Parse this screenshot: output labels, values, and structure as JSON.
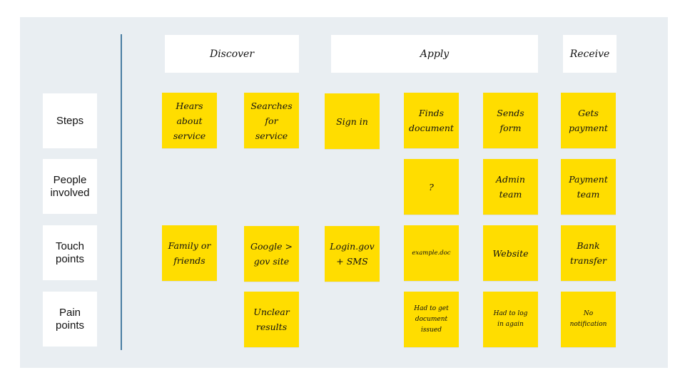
{
  "phases": [
    {
      "label": "Discover"
    },
    {
      "label": "Apply"
    },
    {
      "label": "Receive"
    }
  ],
  "rows": [
    {
      "label": "Steps"
    },
    {
      "label": "People\ninvolved"
    },
    {
      "label": "Touch\npoints"
    },
    {
      "label": "Pain\npoints"
    }
  ],
  "notes": {
    "steps": [
      "Hears\nabout\nservice",
      "Searches\nfor\nservice",
      "Sign in",
      "Finds\ndocument",
      "Sends\nform",
      "Gets\npayment"
    ],
    "people": [
      "",
      "",
      "",
      "?",
      "Admin\nteam",
      "Payment\nteam"
    ],
    "touch": [
      "Family or\nfriends",
      "Google >\ngov site",
      "Login.gov\n+ SMS",
      "example.doc",
      "Website",
      "Bank\ntransfer"
    ],
    "pain": [
      "",
      "Unclear\nresults",
      "",
      "Had to get\ndocument\nissued",
      "Had to log\nin again",
      "No\nnotification"
    ]
  },
  "colors": {
    "background": "#e9eef2",
    "sticky": "#ffdd00",
    "divider": "#4a7ea3",
    "card": "#ffffff"
  }
}
